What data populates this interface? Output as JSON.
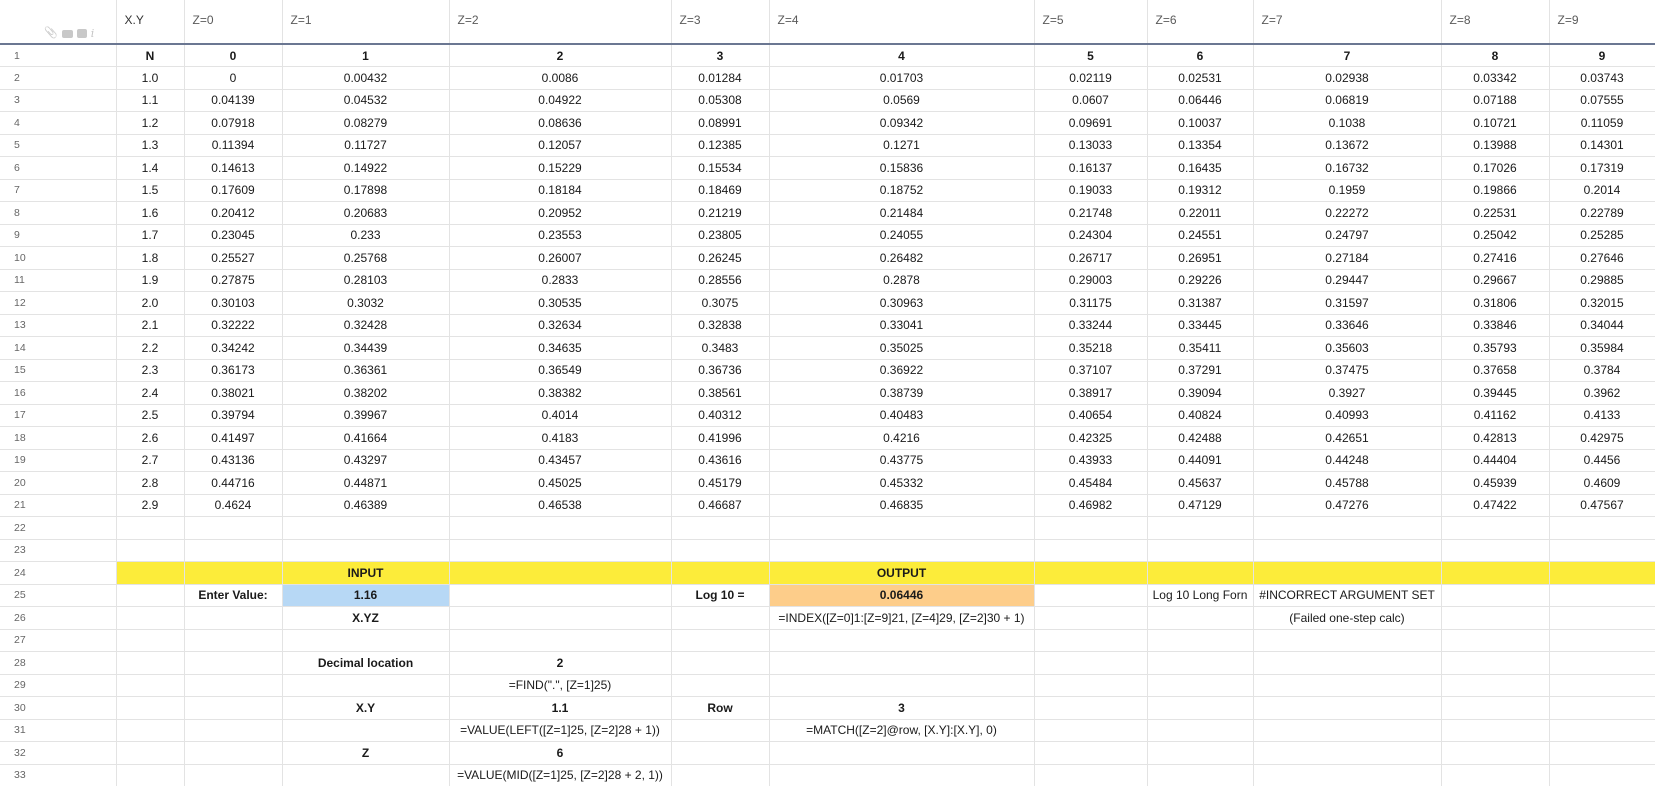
{
  "columns": [
    "X.Y",
    "Z=0",
    "Z=1",
    "Z=2",
    "Z=3",
    "Z=4",
    "Z=5",
    "Z=6",
    "Z=7",
    "Z=8",
    "Z=9"
  ],
  "header_row": [
    "N",
    "0",
    "1",
    "2",
    "3",
    "4",
    "5",
    "6",
    "7",
    "8",
    "9"
  ],
  "rows": [
    [
      "1.0",
      "0",
      "0.00432",
      "0.0086",
      "0.01284",
      "0.01703",
      "0.02119",
      "0.02531",
      "0.02938",
      "0.03342",
      "0.03743"
    ],
    [
      "1.1",
      "0.04139",
      "0.04532",
      "0.04922",
      "0.05308",
      "0.0569",
      "0.0607",
      "0.06446",
      "0.06819",
      "0.07188",
      "0.07555"
    ],
    [
      "1.2",
      "0.07918",
      "0.08279",
      "0.08636",
      "0.08991",
      "0.09342",
      "0.09691",
      "0.10037",
      "0.1038",
      "0.10721",
      "0.11059"
    ],
    [
      "1.3",
      "0.11394",
      "0.11727",
      "0.12057",
      "0.12385",
      "0.1271",
      "0.13033",
      "0.13354",
      "0.13672",
      "0.13988",
      "0.14301"
    ],
    [
      "1.4",
      "0.14613",
      "0.14922",
      "0.15229",
      "0.15534",
      "0.15836",
      "0.16137",
      "0.16435",
      "0.16732",
      "0.17026",
      "0.17319"
    ],
    [
      "1.5",
      "0.17609",
      "0.17898",
      "0.18184",
      "0.18469",
      "0.18752",
      "0.19033",
      "0.19312",
      "0.1959",
      "0.19866",
      "0.2014"
    ],
    [
      "1.6",
      "0.20412",
      "0.20683",
      "0.20952",
      "0.21219",
      "0.21484",
      "0.21748",
      "0.22011",
      "0.22272",
      "0.22531",
      "0.22789"
    ],
    [
      "1.7",
      "0.23045",
      "0.233",
      "0.23553",
      "0.23805",
      "0.24055",
      "0.24304",
      "0.24551",
      "0.24797",
      "0.25042",
      "0.25285"
    ],
    [
      "1.8",
      "0.25527",
      "0.25768",
      "0.26007",
      "0.26245",
      "0.26482",
      "0.26717",
      "0.26951",
      "0.27184",
      "0.27416",
      "0.27646"
    ],
    [
      "1.9",
      "0.27875",
      "0.28103",
      "0.2833",
      "0.28556",
      "0.2878",
      "0.29003",
      "0.29226",
      "0.29447",
      "0.29667",
      "0.29885"
    ],
    [
      "2.0",
      "0.30103",
      "0.3032",
      "0.30535",
      "0.3075",
      "0.30963",
      "0.31175",
      "0.31387",
      "0.31597",
      "0.31806",
      "0.32015"
    ],
    [
      "2.1",
      "0.32222",
      "0.32428",
      "0.32634",
      "0.32838",
      "0.33041",
      "0.33244",
      "0.33445",
      "0.33646",
      "0.33846",
      "0.34044"
    ],
    [
      "2.2",
      "0.34242",
      "0.34439",
      "0.34635",
      "0.3483",
      "0.35025",
      "0.35218",
      "0.35411",
      "0.35603",
      "0.35793",
      "0.35984"
    ],
    [
      "2.3",
      "0.36173",
      "0.36361",
      "0.36549",
      "0.36736",
      "0.36922",
      "0.37107",
      "0.37291",
      "0.37475",
      "0.37658",
      "0.3784"
    ],
    [
      "2.4",
      "0.38021",
      "0.38202",
      "0.38382",
      "0.38561",
      "0.38739",
      "0.38917",
      "0.39094",
      "0.3927",
      "0.39445",
      "0.3962"
    ],
    [
      "2.5",
      "0.39794",
      "0.39967",
      "0.4014",
      "0.40312",
      "0.40483",
      "0.40654",
      "0.40824",
      "0.40993",
      "0.41162",
      "0.4133"
    ],
    [
      "2.6",
      "0.41497",
      "0.41664",
      "0.4183",
      "0.41996",
      "0.4216",
      "0.42325",
      "0.42488",
      "0.42651",
      "0.42813",
      "0.42975"
    ],
    [
      "2.7",
      "0.43136",
      "0.43297",
      "0.43457",
      "0.43616",
      "0.43775",
      "0.43933",
      "0.44091",
      "0.44248",
      "0.44404",
      "0.4456"
    ],
    [
      "2.8",
      "0.44716",
      "0.44871",
      "0.45025",
      "0.45179",
      "0.45332",
      "0.45484",
      "0.45637",
      "0.45788",
      "0.45939",
      "0.4609"
    ],
    [
      "2.9",
      "0.4624",
      "0.46389",
      "0.46538",
      "0.46687",
      "0.46835",
      "0.46982",
      "0.47129",
      "0.47276",
      "0.47422",
      "0.47567"
    ]
  ],
  "calc": {
    "input_label": "INPUT",
    "output_label": "OUTPUT",
    "enter_value_label": "Enter Value:",
    "enter_value": "1.16",
    "format_hint": "X.YZ",
    "log_label": "Log 10 =",
    "log_value": "0.06446",
    "log_formula": "=INDEX([Z=0]1:[Z=9]21, [Z=4]29, [Z=2]30 + 1)",
    "long_form_label": "Log 10 Long Forn",
    "long_form_value": "#INCORRECT ARGUMENT SET",
    "long_form_note": "(Failed one-step calc)",
    "decimal_location_label": "Decimal location",
    "decimal_location_value": "2",
    "decimal_location_formula": "=FIND(\".\", [Z=1]25)",
    "xy_label": "X.Y",
    "xy_value": "1.1",
    "xy_formula": "=VALUE(LEFT([Z=1]25, [Z=2]28 + 1))",
    "row_label": "Row",
    "row_value": "3",
    "row_formula": "=MATCH([Z=2]@row, [X.Y]:[X.Y], 0)",
    "z_label": "Z",
    "z_value": "6",
    "z_formula": "=VALUE(MID([Z=1]25, [Z=2]28 + 2, 1))"
  },
  "colors": {
    "header_band": "#fcec3a",
    "input_cell": "#b7d8f5",
    "output_cell": "#fdcd8a",
    "header_underline": "#6b7792"
  },
  "icons": [
    "attachment-icon",
    "comment-icon",
    "proof-icon",
    "info-icon"
  ]
}
